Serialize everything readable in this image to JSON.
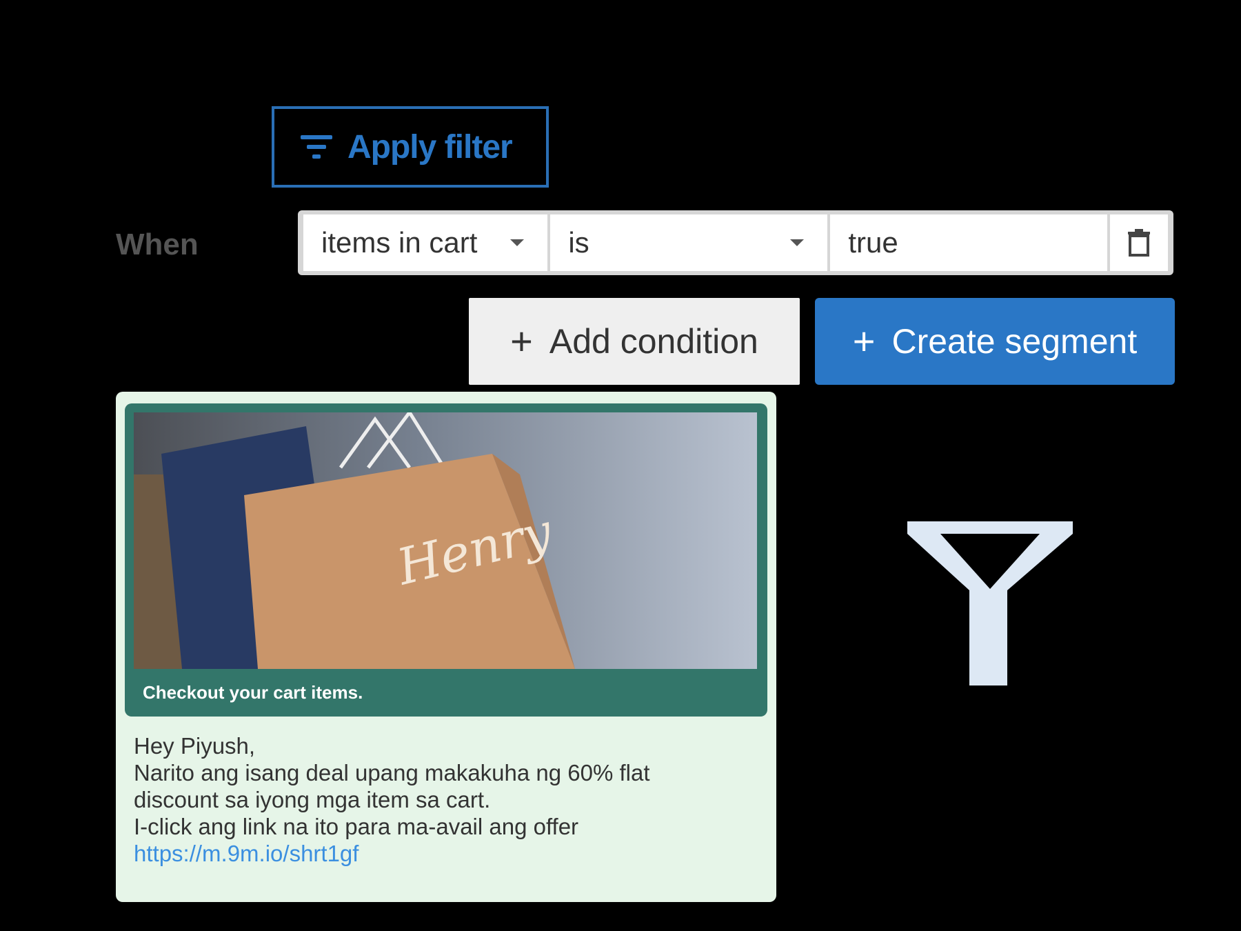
{
  "filter": {
    "apply_label": "Apply filter",
    "icon": "filter-icon"
  },
  "condition": {
    "when_label": "When",
    "field": "items in cart",
    "operator": "is",
    "value": "true",
    "delete_icon": "trash-icon"
  },
  "actions": {
    "add_condition": "Add condition",
    "create_segment": "Create segment"
  },
  "message": {
    "caption": "Checkout your cart items.",
    "bag_text": "Henry",
    "greeting": "Hey Piyush,",
    "body_line1": "Narito ang isang deal upang makakuha ng 60% flat discount sa iyong mga item sa cart.",
    "body_line2": "I-click ang link na ito para ma-avail ang offer",
    "link": "https://m.9m.io/shrt1gf"
  },
  "colors": {
    "primary": "#2a77c6",
    "card_bg": "#e6f5e8",
    "card_header": "#33766a",
    "funnel": "#dde8f4"
  }
}
